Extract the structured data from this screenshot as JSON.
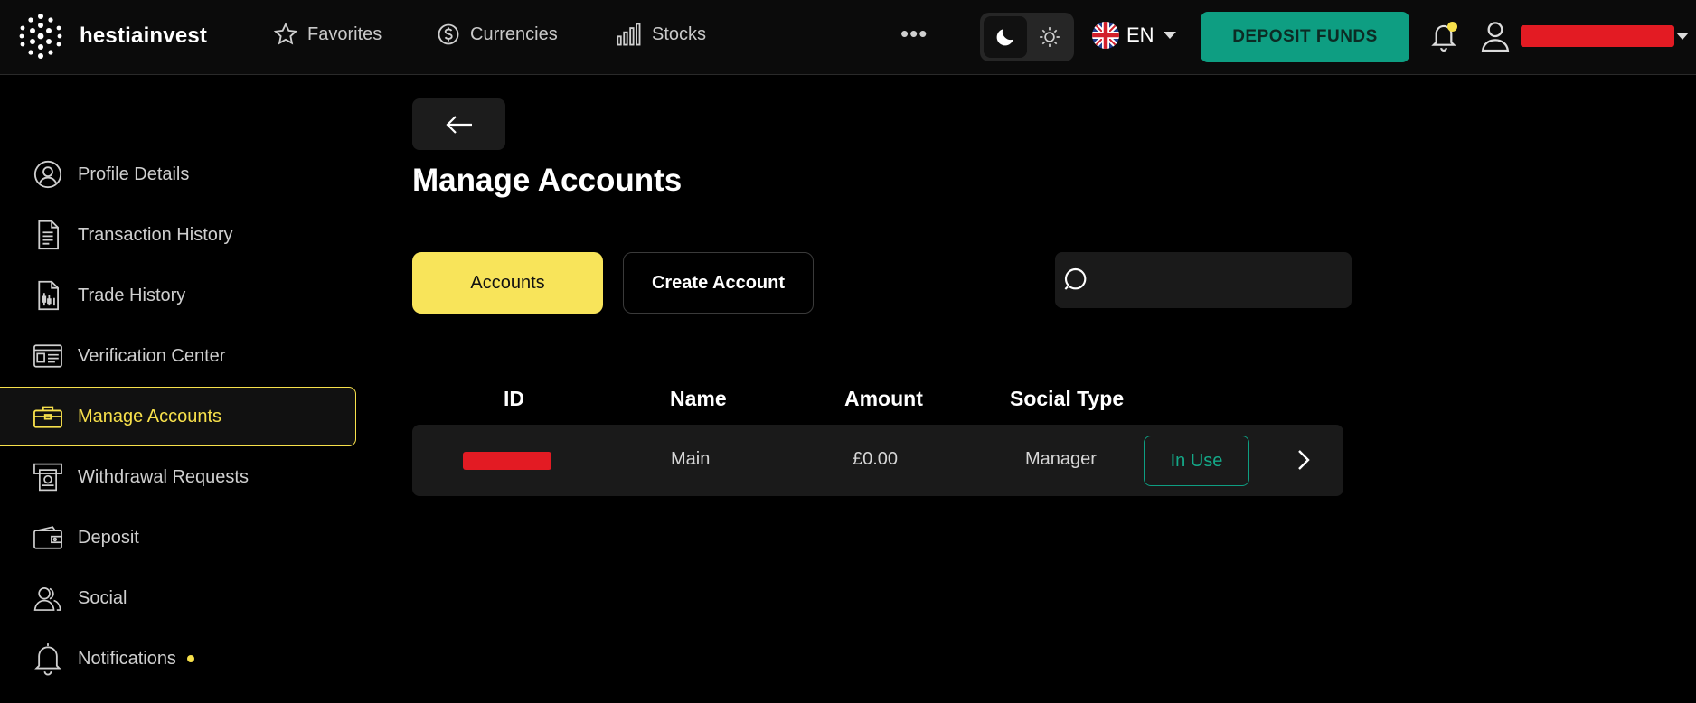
{
  "brand": {
    "name": "hestiainvest",
    "accent": "#f7e04b",
    "primary": "#0e9e82",
    "icon": "dot-grid-logo-icon"
  },
  "topnav": {
    "items": [
      {
        "label": "Favorites",
        "icon": "star-icon"
      },
      {
        "label": "Currencies",
        "icon": "currency-icon"
      },
      {
        "label": "Stocks",
        "icon": "bar-chart-icon"
      }
    ],
    "more_label": "•••",
    "language": "EN",
    "deposit_label": "DEPOSIT FUNDS"
  },
  "sidebar": {
    "items": [
      {
        "label": "Profile Details",
        "icon": "user-circle-icon"
      },
      {
        "label": "Transaction History",
        "icon": "document-icon"
      },
      {
        "label": "Trade History",
        "icon": "trade-document-icon"
      },
      {
        "label": "Verification Center",
        "icon": "id-card-icon"
      },
      {
        "label": "Manage Accounts",
        "icon": "briefcase-icon",
        "active": true
      },
      {
        "label": "Withdrawal Requests",
        "icon": "atm-icon"
      },
      {
        "label": "Deposit",
        "icon": "wallet-icon"
      },
      {
        "label": "Social",
        "icon": "users-icon"
      },
      {
        "label": "Notifications",
        "icon": "bell-icon"
      }
    ]
  },
  "main": {
    "title": "Manage Accounts",
    "tabs": {
      "accounts": "Accounts",
      "create": "Create Account"
    },
    "search": {
      "placeholder": ""
    },
    "table": {
      "headers": [
        "ID",
        "Name",
        "Amount",
        "Social Type"
      ],
      "rows": [
        {
          "id": "",
          "name": "Main",
          "amount": "£0.00",
          "social_type": "Manager",
          "status": "In Use"
        }
      ]
    }
  }
}
